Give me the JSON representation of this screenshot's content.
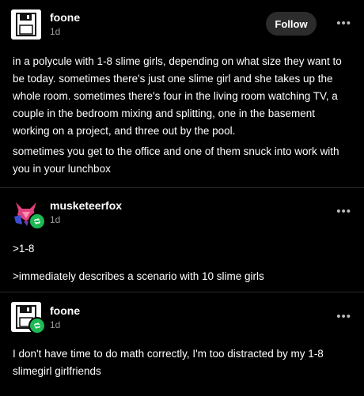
{
  "posts": [
    {
      "username": "foone",
      "time": "1d",
      "follow_label": "Follow",
      "more_label": "•••",
      "paragraphs": [
        "in a polycule with 1-8 slime girls, depending on what size they want to be today. sometimes there's just one slime girl and she takes up the whole room. sometimes there's four in the living room watching TV, a couple in the bedroom mixing and splitting, one in the basement working on a project, and three out by the pool.",
        "sometimes you get to the office and one of them snuck into work with you in your lunchbox"
      ]
    },
    {
      "username": "musketeerfox",
      "time": "1d",
      "more_label": "•••",
      "paragraphs": [
        ">1-8",
        ">immediately describes a scenario with 10 slime girls"
      ]
    },
    {
      "username": "foone",
      "time": "1d",
      "more_label": "•••",
      "paragraphs": [
        "I don't have time to do math correctly, I'm too distracted by my 1-8 slimegirl girlfriends"
      ]
    }
  ],
  "icons": {
    "avatar_floppy": "floppy-disk-avatar",
    "avatar_fox": "fox-avatar",
    "reblog": "reblog-icon",
    "more": "more-options-icon"
  },
  "colors": {
    "background": "#000000",
    "text": "#ffffff",
    "muted": "#9a9a9a",
    "follow_bg": "#2c2c2c",
    "reblog_badge": "#1db954",
    "fox_pink": "#e0407a",
    "fox_blue": "#3a4fd0"
  }
}
